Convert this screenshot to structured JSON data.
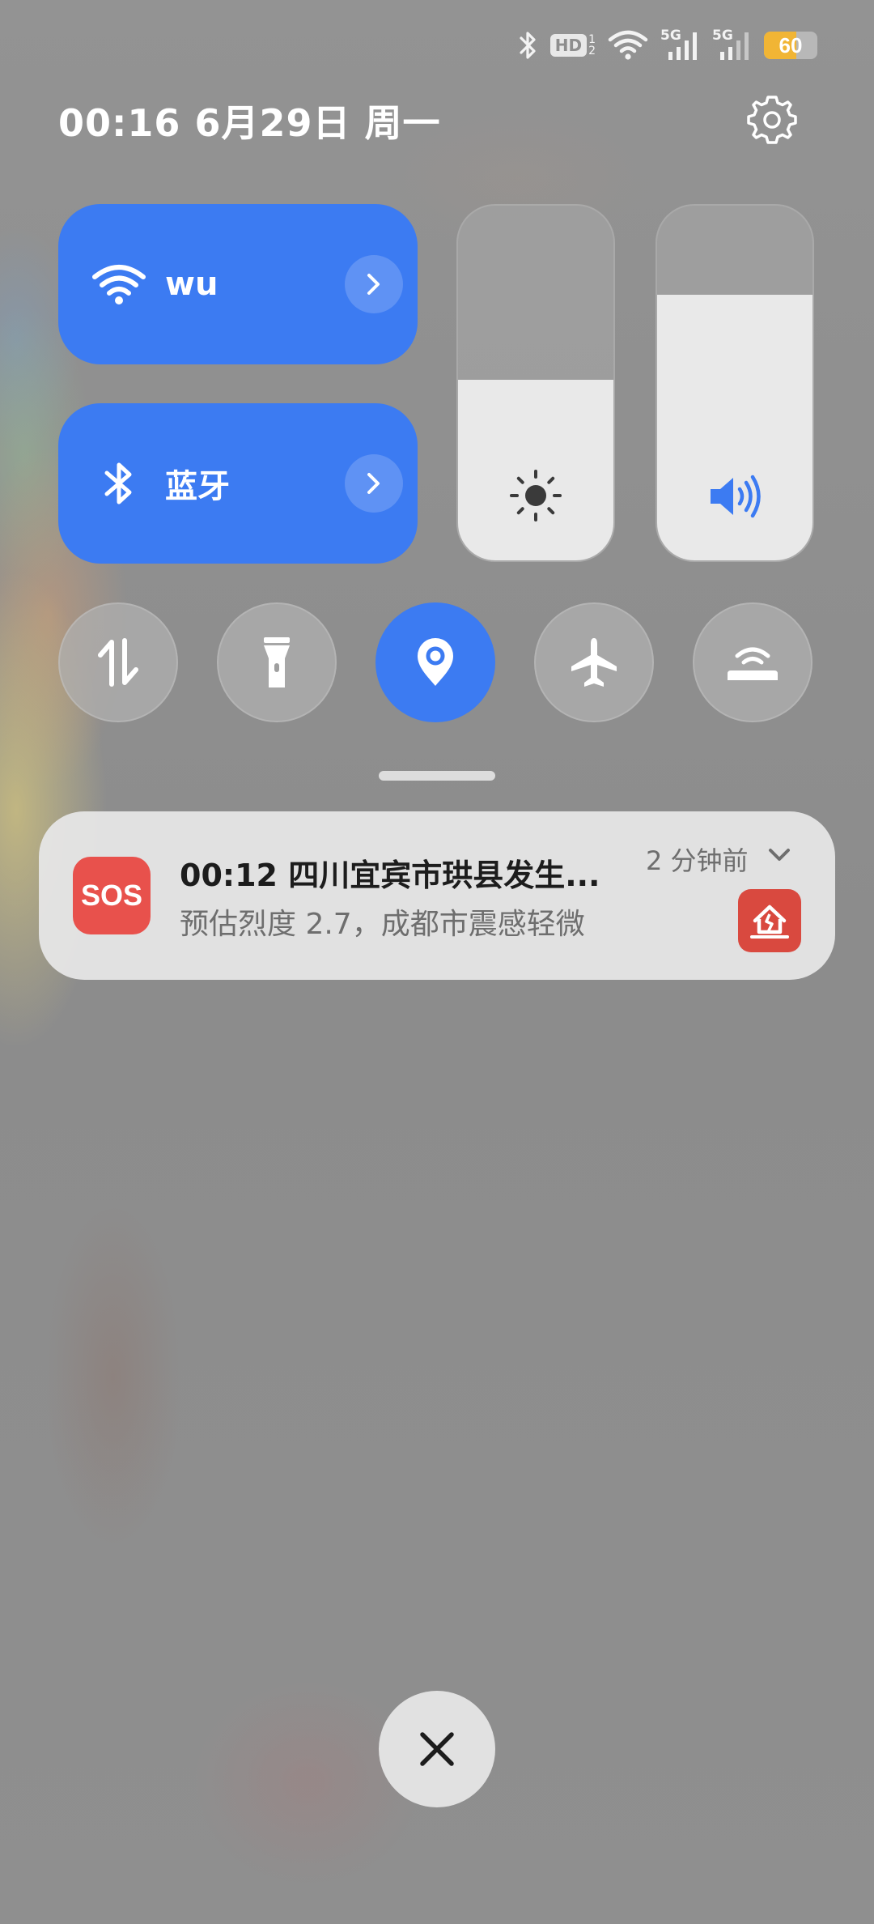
{
  "status_bar": {
    "icons": [
      "bluetooth-icon",
      "hd-icon",
      "wifi-icon",
      "signal-5g-icon",
      "signal-5g-icon",
      "battery-icon"
    ],
    "hd_label": "HD",
    "hd_sub_top": "1",
    "hd_sub_bottom": "2",
    "network_label_1": "5G",
    "network_label_2": "5G",
    "battery_level": "60",
    "battery_color": "#f1b535"
  },
  "header": {
    "datetime": "00:16 6月29日 周一",
    "settings_icon": "gear-icon"
  },
  "tiles": {
    "wifi": {
      "label": "wu",
      "icon": "wifi-icon",
      "active": true
    },
    "bluetooth": {
      "label": "蓝牙",
      "icon": "bluetooth-icon",
      "active": true
    }
  },
  "sliders": {
    "brightness": {
      "icon": "brightness-icon",
      "level_fraction": 0.51
    },
    "volume": {
      "icon": "volume-icon",
      "level_fraction": 0.75
    }
  },
  "toggles": [
    {
      "name": "mobile-data",
      "icon": "data-transfer-icon",
      "active": false
    },
    {
      "name": "flashlight",
      "icon": "flashlight-icon",
      "active": false
    },
    {
      "name": "location",
      "icon": "location-icon",
      "active": true
    },
    {
      "name": "airplane-mode",
      "icon": "airplane-icon",
      "active": false
    },
    {
      "name": "hotspot",
      "icon": "hotspot-icon",
      "active": false
    }
  ],
  "notification": {
    "app_icon_label": "SOS",
    "title": "00:12 四川宜宾市珙县发生...",
    "body": "预估烈度 2.7，成都市震感轻微",
    "time": "2 分钟前",
    "badge_icon": "earthquake-house-icon"
  },
  "colors": {
    "accent": "#3c7bf2",
    "sos": "#e8514c"
  },
  "close_icon": "close-icon"
}
